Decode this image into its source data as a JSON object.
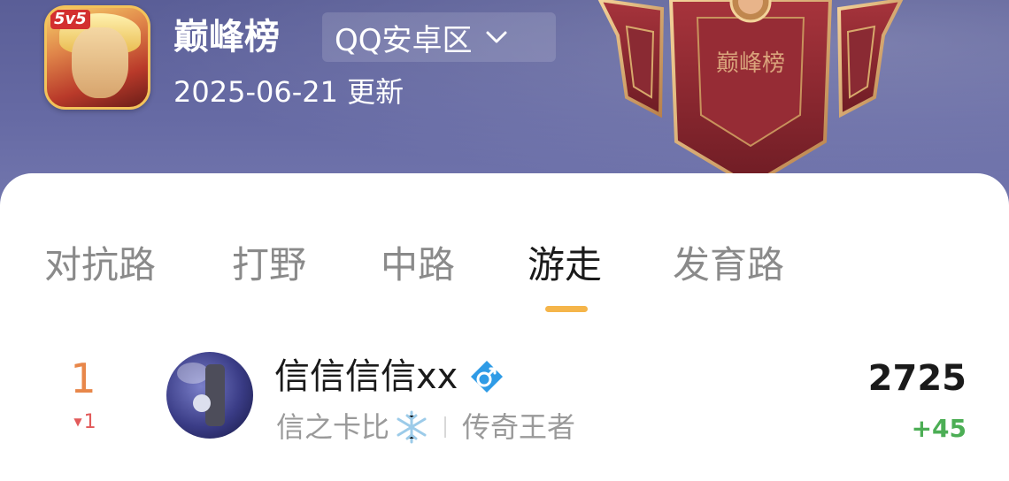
{
  "header": {
    "app_badge": "5v5",
    "title": "巅峰榜",
    "region": "QQ安卓区",
    "update_text": "2025-06-21 更新",
    "emblem_label": "巅峰榜"
  },
  "tabs": [
    {
      "label": "对抗路",
      "active": false
    },
    {
      "label": "打野",
      "active": false
    },
    {
      "label": "中路",
      "active": false
    },
    {
      "label": "游走",
      "active": true
    },
    {
      "label": "发育路",
      "active": false
    }
  ],
  "entry": {
    "rank": "1",
    "rank_change": "1",
    "rank_change_direction": "down",
    "name": "信信信信xx",
    "title": "信之卡比",
    "tier": "传奇王者",
    "score": "2725",
    "score_change": "+45"
  },
  "colors": {
    "header_bg": "#5b5f9a",
    "accent": "#f5b54a",
    "rank_color": "#e8874a",
    "rank_change_color": "#e25a5a",
    "score_change_color": "#4cae55",
    "emblem_red": "#8e2530"
  },
  "icons": {
    "region_dropdown": "chevron-down-icon",
    "gender": "male-gender-icon",
    "title_badge": "snowflake-icon"
  }
}
